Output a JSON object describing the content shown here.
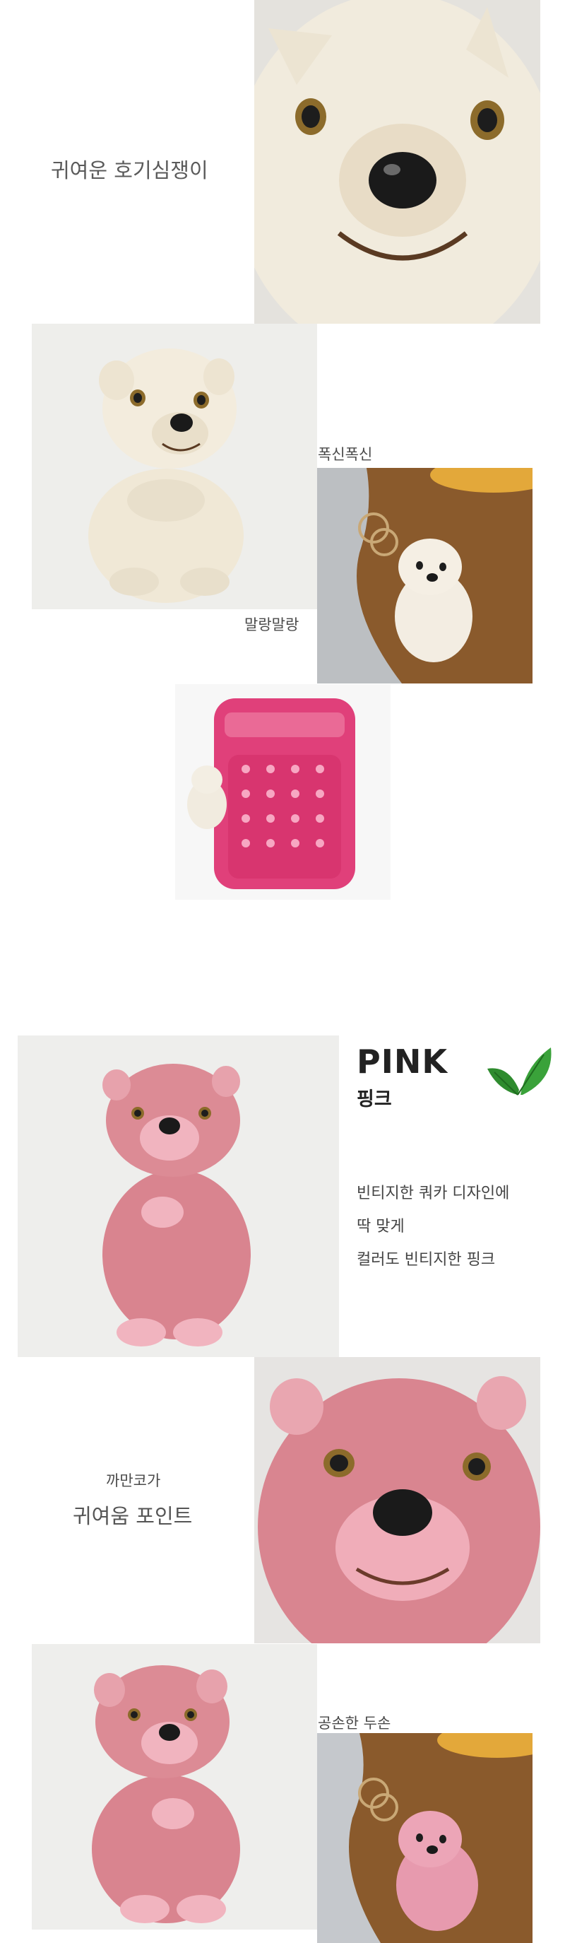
{
  "white_section": {
    "headline": "귀여운 호기심쟁이",
    "caption_soft": "말랑말랑",
    "caption_fluffy": "폭신폭신"
  },
  "pink_section": {
    "color_name_en": "PINK",
    "color_name_ko": "핑크",
    "description_lines": [
      "빈티지한 쿼카 디자인에",
      "딱 맞게",
      "컬러도 빈티지한 핑크"
    ],
    "point_small": "까만코가",
    "point_large": "귀여움 포인트",
    "caption_paws": "공손한 두손"
  },
  "colors": {
    "white_plush": "#efe7d6",
    "pink_plush": "#d9848f",
    "backpack": "#e0407a",
    "corduroy": "#8a5a2c",
    "leaf": "#2e8b2e"
  },
  "icons": [
    "leaf-icon"
  ]
}
